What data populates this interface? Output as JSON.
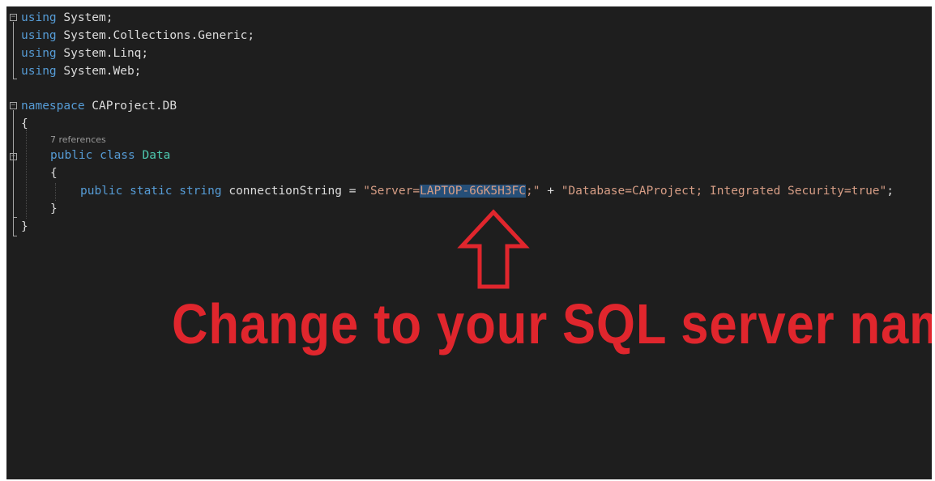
{
  "code": {
    "l1_kw": "using",
    "l1_rest": " System;",
    "l2_kw": "using",
    "l2_rest": " System.Collections.Generic;",
    "l3_kw": "using",
    "l3_rest": " System.Linq;",
    "l4_kw": "using",
    "l4_rest": " System.Web;",
    "ns_kw": "namespace",
    "ns_name": " CAProject.DB",
    "open_brace": "{",
    "codelens": "7 references",
    "class_kw": "public class",
    "class_name": " Data",
    "class_open": "{",
    "field_kw": "public static string",
    "field_name": " connectionString = ",
    "str1_prefix": "\"Server=",
    "str1_selected": "LAPTOP-6GK5H3FC",
    "str1_suffix": ";\"",
    "concat": " + ",
    "str2": "\"Database=CAProject; Integrated Security=true\"",
    "semicolon": ";",
    "class_close": "}",
    "ns_close": "}"
  },
  "annotation": {
    "text": "Change to your SQL server name",
    "color": "#e0262d",
    "arrow": "up-arrow-icon"
  },
  "theme": {
    "background": "#1e1e1e",
    "keyword": "#569cd6",
    "type": "#4ec9b0",
    "string": "#d69d85",
    "selection": "#264f78"
  }
}
